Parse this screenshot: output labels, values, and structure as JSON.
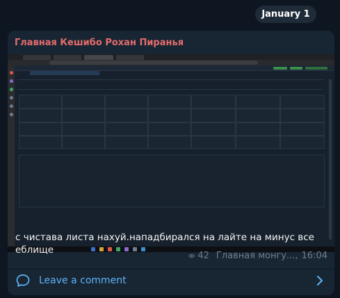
{
  "date_pill": "January 1",
  "post": {
    "channel_name": "Главная Кешибо Рохан Пиранья",
    "caption": "с чистава листа нахуй.нападбирался на лайте на минус все еблище",
    "views": "42",
    "author": "Главная монгу...,",
    "time": "16:04",
    "comment_label": "Leave a comment"
  },
  "colors": {
    "background": "#0e1621",
    "bubble": "#182533",
    "channel_name": "#e46d6d",
    "link": "#5eb5f7",
    "meta": "#6d7f8f"
  },
  "icons": {
    "views": "eye-icon",
    "comment": "speech-bubble-icon",
    "open": "chevron-right-icon"
  }
}
